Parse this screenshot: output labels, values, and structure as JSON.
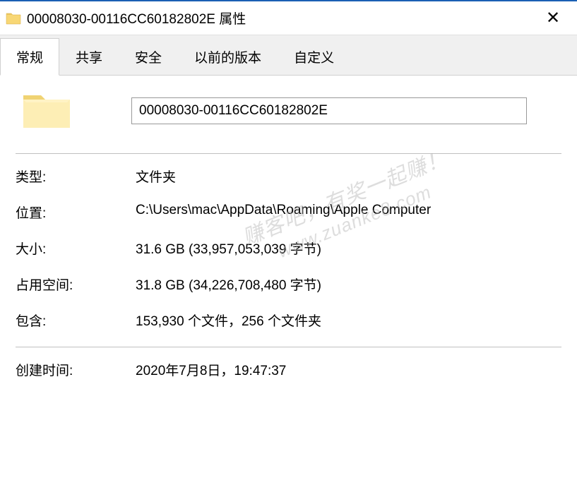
{
  "titlebar": {
    "title": "00008030-00116CC60182802E 属性"
  },
  "tabs": [
    {
      "label": "常规",
      "active": true
    },
    {
      "label": "共享",
      "active": false
    },
    {
      "label": "安全",
      "active": false
    },
    {
      "label": "以前的版本",
      "active": false
    },
    {
      "label": "自定义",
      "active": false
    }
  ],
  "folder_name": "00008030-00116CC60182802E",
  "properties": {
    "type_label": "类型:",
    "type_value": "文件夹",
    "location_label": "位置:",
    "location_value": "C:\\Users\\mac\\AppData\\Roaming\\Apple Computer",
    "size_label": "大小:",
    "size_value": "31.6 GB (33,957,053,039 字节)",
    "size_on_disk_label": "占用空间:",
    "size_on_disk_value": "31.8 GB (34,226,708,480 字节)",
    "contains_label": "包含:",
    "contains_value": "153,930 个文件，256 个文件夹",
    "created_label": "创建时间:",
    "created_value": "2020年7月8日，19:47:37"
  },
  "watermark": {
    "line1": "赚客吧，有奖一起赚！",
    "line2": "www.zuanke8.com"
  }
}
